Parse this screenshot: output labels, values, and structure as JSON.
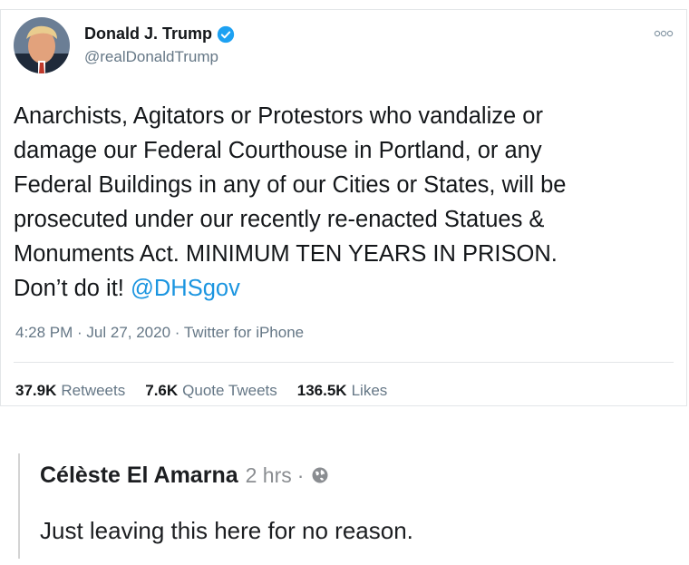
{
  "tweet": {
    "author_name": "Donald J. Trump",
    "author_handle": "@realDonaldTrump",
    "text_lines": [
      "Anarchists, Agitators or Protestors who vandalize or",
      "damage our Federal Courthouse in Portland, or any",
      "Federal Buildings in any of our Cities or States, will be",
      "prosecuted under our recently re-enacted Statues &",
      "Monuments Act. MINIMUM TEN YEARS IN PRISON.",
      "Don’t do it! "
    ],
    "mention": "@DHSgov",
    "meta": "4:28 PM · Jul 27, 2020 · Twitter for iPhone",
    "stats": {
      "retweets_count": "37.9K",
      "retweets_label": "Retweets",
      "quotes_count": "7.6K",
      "quotes_label": "Quote Tweets",
      "likes_count": "136.5K",
      "likes_label": "Likes"
    },
    "icons": {
      "verified": "verified-badge-icon",
      "more": "more-options-icon"
    },
    "colors": {
      "link": "#1b95e0",
      "verified": "#1da1f2"
    }
  },
  "comment": {
    "author": "Célèste El Amarna",
    "time": "2 hrs",
    "separator": "·",
    "text": "Just leaving this here for no reason.",
    "privacy_icon": "globe-icon"
  }
}
